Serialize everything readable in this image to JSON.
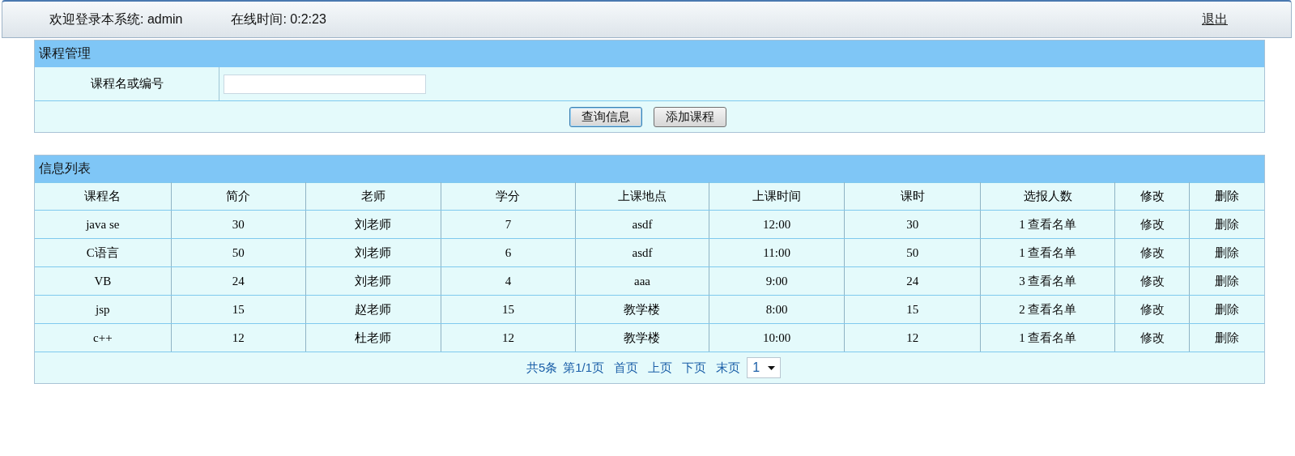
{
  "header": {
    "welcome": "欢迎登录本系统: admin",
    "online_time": "在线时间: 0:2:23",
    "logout": "退出"
  },
  "search_panel": {
    "title": "课程管理",
    "field_label": "课程名或编号",
    "buttons": [
      "查询信息",
      "添加课程"
    ]
  },
  "list_panel": {
    "title": "信息列表",
    "columns": [
      "课程名",
      "简介",
      "老师",
      "学分",
      "上课地点",
      "上课时间",
      "课时",
      "选报人数",
      "修改",
      "删除"
    ],
    "rows": [
      {
        "cells": [
          "java se",
          "30",
          "刘老师",
          "7",
          "asdf",
          "12:00",
          "30"
        ],
        "enrolled": "1",
        "roster_link": "查看名单",
        "edit": "修改",
        "delete": "删除"
      },
      {
        "cells": [
          "C语言",
          "50",
          "刘老师",
          "6",
          "asdf",
          "11:00",
          "50"
        ],
        "enrolled": "1",
        "roster_link": "查看名单",
        "edit": "修改",
        "delete": "删除"
      },
      {
        "cells": [
          "VB",
          "24",
          "刘老师",
          "4",
          "aaa",
          "9:00",
          "24"
        ],
        "enrolled": "3",
        "roster_link": "查看名单",
        "edit": "修改",
        "delete": "删除"
      },
      {
        "cells": [
          "jsp",
          "15",
          "赵老师",
          "15",
          "教学楼",
          "8:00",
          "15"
        ],
        "enrolled": "2",
        "roster_link": "查看名单",
        "edit": "修改",
        "delete": "删除"
      },
      {
        "cells": [
          "c++",
          "12",
          "杜老师",
          "12",
          "教学楼",
          "10:00",
          "12"
        ],
        "enrolled": "1",
        "roster_link": "查看名单",
        "edit": "修改",
        "delete": "删除"
      }
    ],
    "pagination": {
      "total": "共5条",
      "page": "第1/1页",
      "links": [
        "首页",
        "上页",
        "下页",
        "末页"
      ],
      "page_select": "1"
    }
  }
}
